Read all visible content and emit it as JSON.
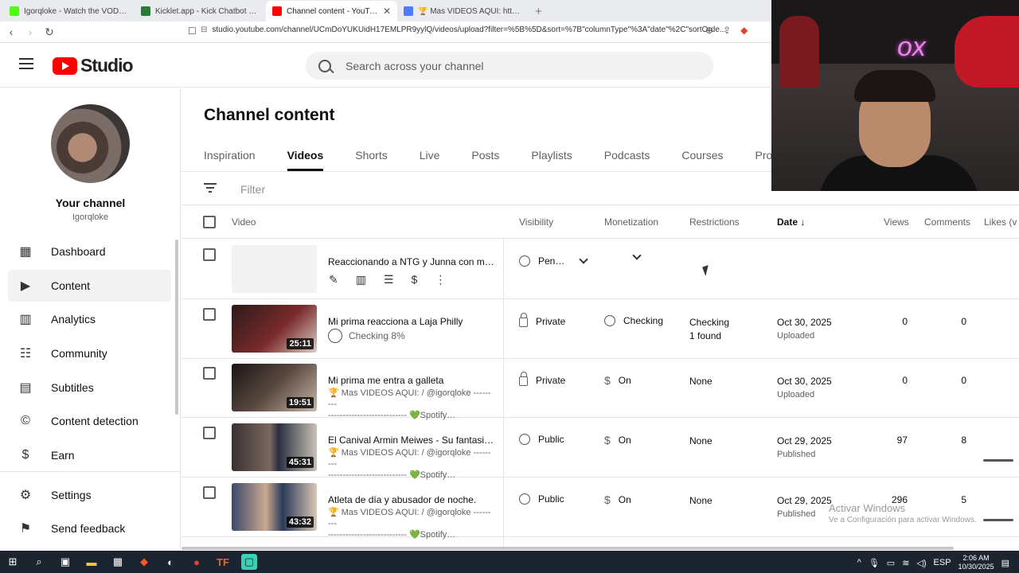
{
  "browser": {
    "tabs": [
      {
        "title": "Igorqloke - Watch the VOD on Kick",
        "color": "#53fc18",
        "active": false
      },
      {
        "title": "Kicklet.app - Kick Chatbot and Overl…",
        "color": "#2a7a3a",
        "active": false
      },
      {
        "title": "Channel content - YouTube Studi…",
        "color": "#ff0000",
        "active": true
      },
      {
        "title": "🏆 Mas VIDEOS AQUI: https://www…",
        "color": "#4f7cff",
        "active": false
      }
    ],
    "url": "studio.youtube.com/channel/UCmDoYUKUidH17EMLPR9yylQ/videos/upload?filter=%5B%5D&sort=%7B\"columnType\"%3A\"date\"%2C\"sortOrde..."
  },
  "header": {
    "logo_text": "Studio",
    "search_placeholder": "Search across your channel"
  },
  "sidebar": {
    "channel_name": "Your channel",
    "handle": "Igorqloke",
    "items": [
      {
        "label": "Dashboard",
        "icon": "dashboard-icon",
        "glyph": "▦"
      },
      {
        "label": "Content",
        "icon": "content-icon",
        "glyph": "▶",
        "active": true
      },
      {
        "label": "Analytics",
        "icon": "analytics-icon",
        "glyph": "📊"
      },
      {
        "label": "Community",
        "icon": "community-icon",
        "glyph": "👥"
      },
      {
        "label": "Subtitles",
        "icon": "subtitles-icon",
        "glyph": "▤"
      },
      {
        "label": "Content detection",
        "icon": "content-detection-icon",
        "glyph": "©"
      },
      {
        "label": "Earn",
        "icon": "earn-icon",
        "glyph": "$"
      },
      {
        "label": "Settings",
        "icon": "settings-icon",
        "glyph": "⚙"
      },
      {
        "label": "Send feedback",
        "icon": "feedback-icon",
        "glyph": "!"
      }
    ]
  },
  "main": {
    "title": "Channel content",
    "tabs": [
      "Inspiration",
      "Videos",
      "Shorts",
      "Live",
      "Posts",
      "Playlists",
      "Podcasts",
      "Courses",
      "Promo"
    ],
    "active_tab": "Videos",
    "filter_label": "Filter",
    "columns": {
      "video": "Video",
      "visibility": "Visibility",
      "monetization": "Monetization",
      "restrictions": "Restrictions",
      "date": "Date",
      "views": "Views",
      "comments": "Comments",
      "likes": "Likes (v"
    }
  },
  "rows": [
    {
      "title": "Reaccionando a NTG y Junna con mi …",
      "visibility": "Pen…",
      "uploading": true
    },
    {
      "title": "Mi prima reacciona a Laja Philly",
      "duration": "25:11",
      "status": "Checking 8%",
      "visibility": "Private",
      "monetization": "Checking",
      "restrictions": "Checking",
      "restrictions_sub": "1 found",
      "date": "Oct 30, 2025",
      "date_sub": "Uploaded",
      "views": "0",
      "comments": "0",
      "thumb": "#5a1a1a"
    },
    {
      "title": "Mi prima me entra a galleta",
      "duration": "19:51",
      "desc1": "🏆 Mas VIDEOS AQUI: / @igorqloke ---------",
      "desc2": "--------------------------- 💚Spotify…",
      "visibility": "Private",
      "monetization": "On",
      "restrictions": "None",
      "date": "Oct 30, 2025",
      "date_sub": "Uploaded",
      "views": "0",
      "comments": "0",
      "thumb": "#3a3030"
    },
    {
      "title": "El Canival Armin Meiwes - Su fantasia …",
      "duration": "45:31",
      "desc1": "🏆 Mas VIDEOS AQUI: / @igorqloke ---------",
      "desc2": "--------------------------- 💚Spotify…",
      "visibility": "Public",
      "monetization": "On",
      "restrictions": "None",
      "date": "Oct 29, 2025",
      "date_sub": "Published",
      "views": "97",
      "comments": "8",
      "thumb": "#2b2b3a"
    },
    {
      "title": "Atleta de día y abusador de noche.",
      "duration": "43:32",
      "desc1": "🏆 Mas VIDEOS AQUI: / @igorqloke ---------",
      "desc2": "--------------------------- 💚Spotify…",
      "visibility": "Public",
      "monetization": "On",
      "restrictions": "None",
      "date": "Oct 29, 2025",
      "date_sub": "Published",
      "views": "296",
      "comments": "5",
      "thumb": "#2a3a52"
    }
  ],
  "watermark": {
    "line1": "Activar Windows",
    "line2": "Ve a Configuración para activar Windows."
  },
  "taskbar": {
    "lang": "ESP",
    "time": "2:06 AM",
    "date": "10/30/2025"
  }
}
